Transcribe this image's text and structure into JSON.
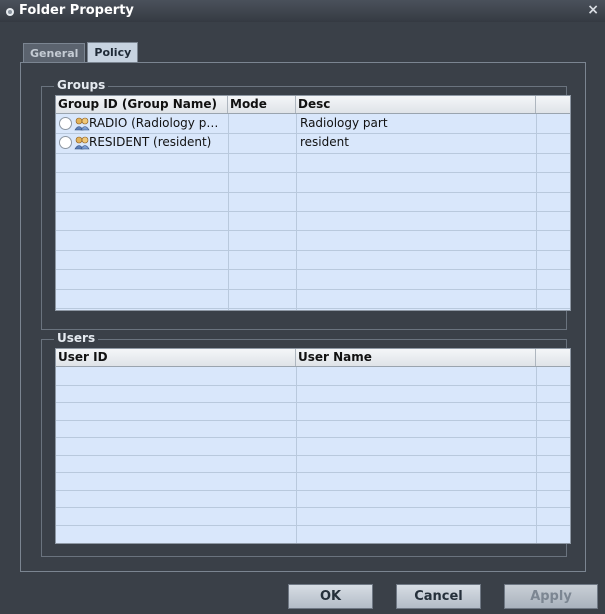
{
  "window": {
    "title": "Folder Property",
    "close_glyph": "×"
  },
  "tabs": [
    {
      "label": "General",
      "active": false
    },
    {
      "label": "Policy",
      "active": true
    }
  ],
  "groups": {
    "label": "Groups",
    "columns": [
      "Group ID (Group Name)",
      "Mode",
      "Desc"
    ],
    "rows": [
      {
        "id": "RADIO (Radiology p…",
        "mode": "",
        "desc": "Radiology part",
        "icon": "user-group-icon"
      },
      {
        "id": "RESIDENT (resident)",
        "mode": "",
        "desc": "resident",
        "icon": "user-group-icon"
      }
    ]
  },
  "users": {
    "label": "Users",
    "columns": [
      "User ID",
      "User Name"
    ],
    "rows": []
  },
  "buttons": {
    "ok": "OK",
    "cancel": "Cancel",
    "apply": "Apply"
  },
  "colors": {
    "window_bg": "#3a4048",
    "grid_bg": "#d9e7fb",
    "tab_active": "#c7d3e0"
  }
}
